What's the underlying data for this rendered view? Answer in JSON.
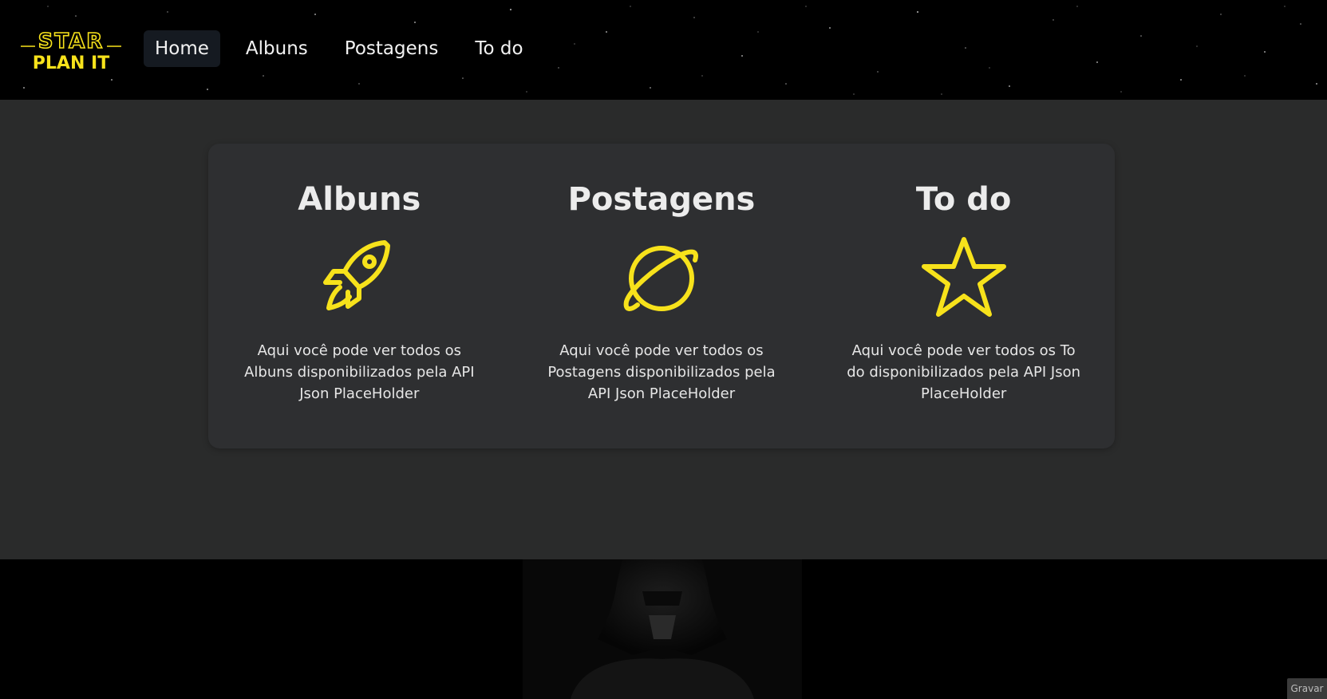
{
  "logo": {
    "line1": "STAR",
    "line2": "PLAN IT",
    "color": "#f7e21b"
  },
  "nav": {
    "items": [
      {
        "label": "Home",
        "active": true
      },
      {
        "label": "Albuns",
        "active": false
      },
      {
        "label": "Postagens",
        "active": false
      },
      {
        "label": "To do",
        "active": false
      }
    ]
  },
  "features": [
    {
      "title": "Albuns",
      "icon": "rocket-icon",
      "description": "Aqui você pode ver todos os Albuns disponibilizados pela API Json PlaceHolder"
    },
    {
      "title": "Postagens",
      "icon": "planet-icon",
      "description": "Aqui você pode ver todos os Postagens disponibilizados pela API Json PlaceHolder"
    },
    {
      "title": "To do",
      "icon": "star-icon",
      "description": "Aqui você pode ver todos os To do disponibilizados pela API Json PlaceHolder"
    }
  ],
  "record_button": {
    "label": "Gravar"
  },
  "colors": {
    "accent": "#f7e21b",
    "main_bg": "#2a2b2b",
    "card_bg": "#2e2f31",
    "nav_active_bg": "#151a21"
  }
}
